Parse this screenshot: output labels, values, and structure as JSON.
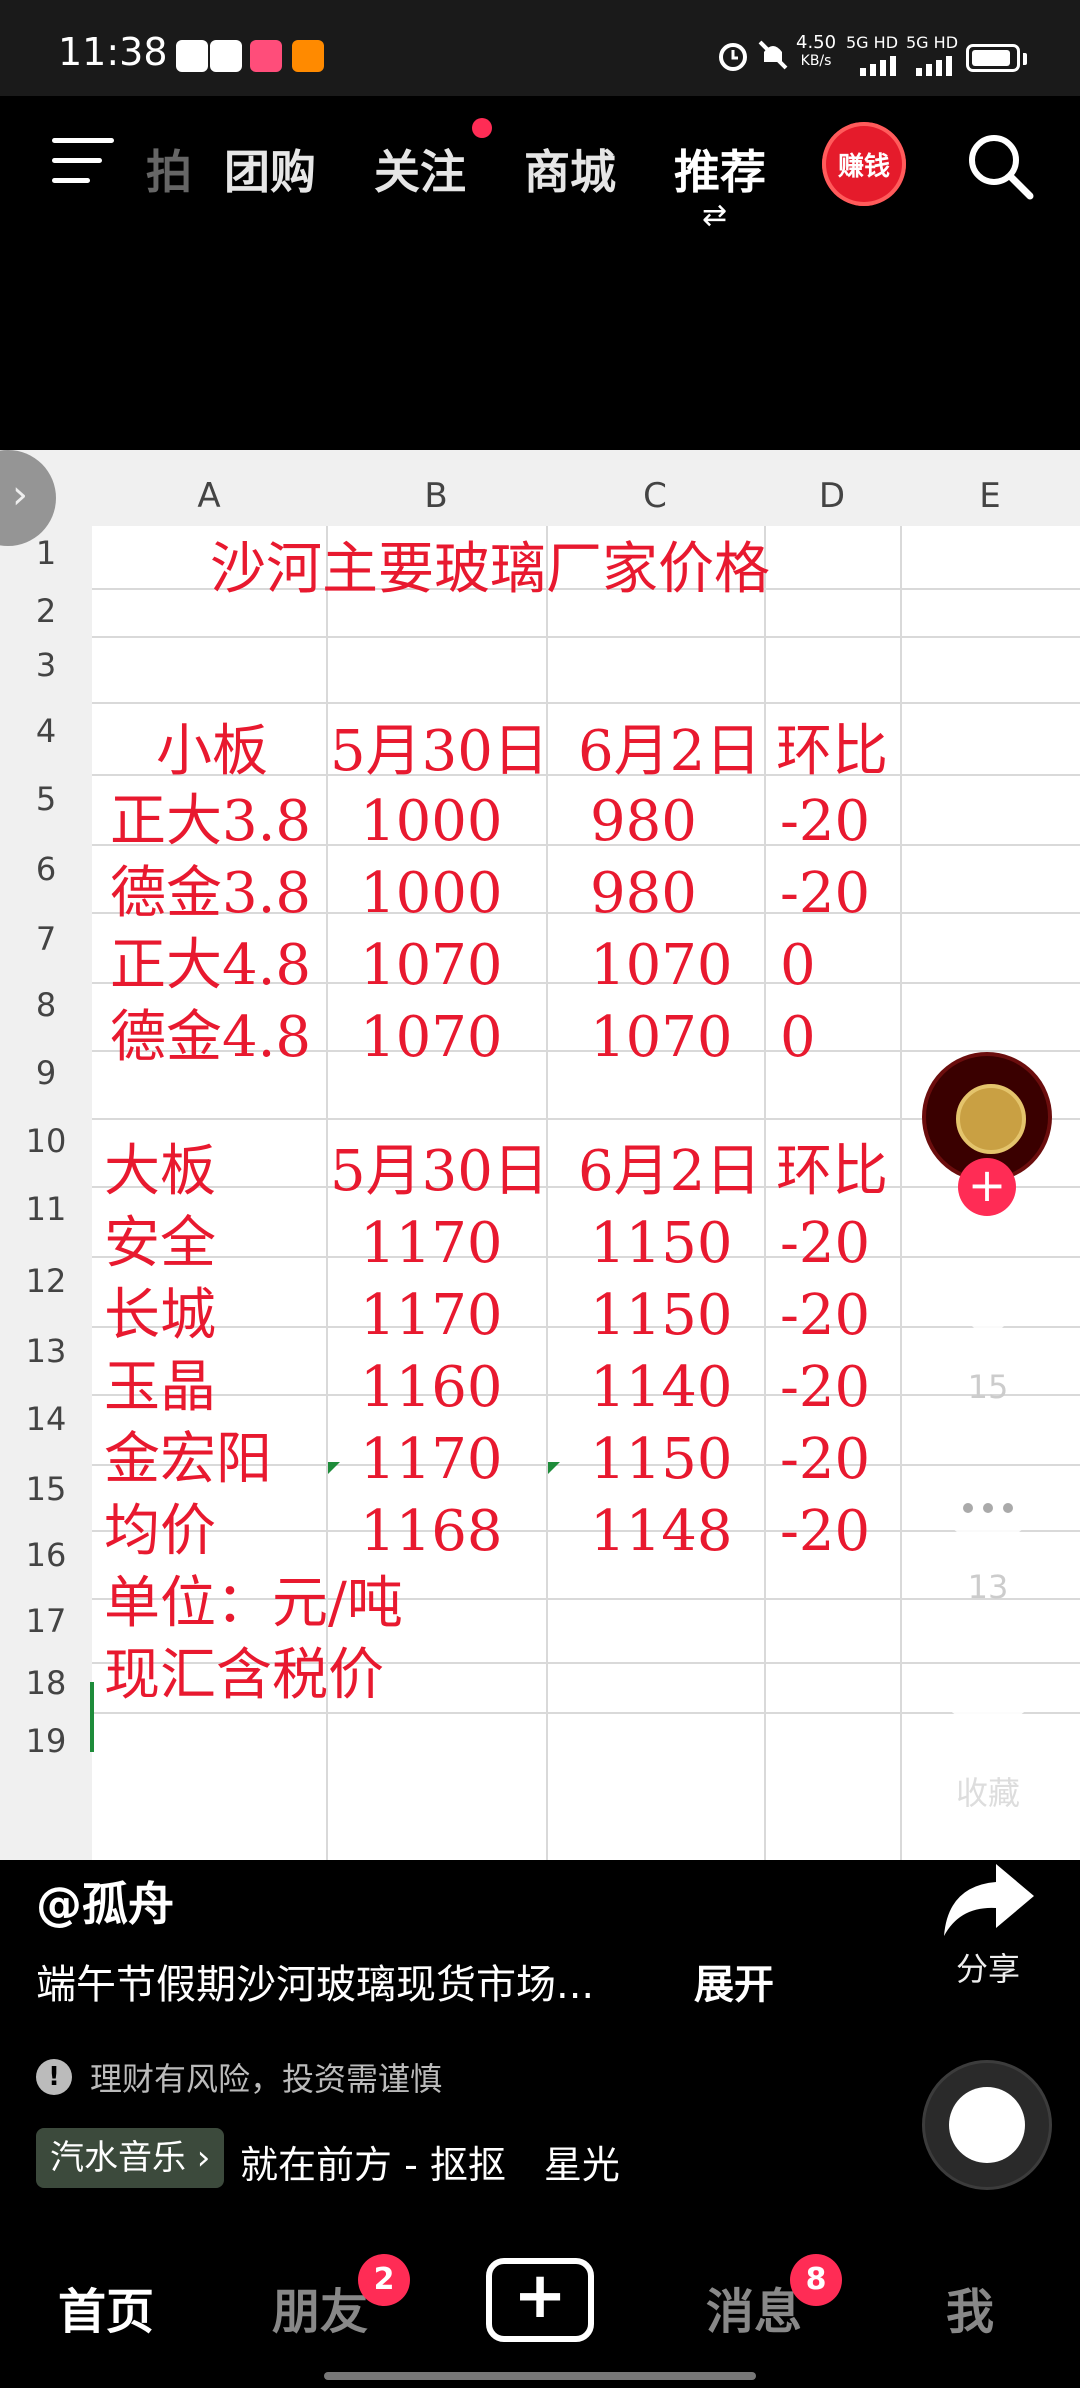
{
  "status": {
    "time": "11:38",
    "net_speed": "4.50",
    "net_unit": "KB/s",
    "sim1": "5G HD",
    "sim2": "5G HD"
  },
  "topnav": {
    "partial_tab": "拍",
    "tabs": [
      "团购",
      "关注",
      "商城",
      "推荐"
    ],
    "earn_label": "赚钱"
  },
  "sheet": {
    "columns": [
      "A",
      "B",
      "C",
      "D",
      "E"
    ],
    "rows": [
      "1",
      "2",
      "3",
      "4",
      "5",
      "6",
      "7",
      "8",
      "9",
      "10",
      "11",
      "12",
      "13",
      "14",
      "15",
      "16",
      "17",
      "18",
      "19"
    ],
    "title": "沙河主要玻璃厂家价格",
    "small": {
      "header": [
        "小板",
        "5月30日",
        "6月2日",
        "环比"
      ],
      "rows": [
        [
          "正大3.8",
          "1000",
          "980",
          "-20"
        ],
        [
          "德金3.8",
          "1000",
          "980",
          "-20"
        ],
        [
          "正大4.8",
          "1070",
          "1070",
          "0"
        ],
        [
          "德金4.8",
          "1070",
          "1070",
          "0"
        ]
      ]
    },
    "large": {
      "header": [
        "大板",
        "5月30日",
        "6月2日",
        "环比"
      ],
      "rows": [
        [
          "安全",
          "1170",
          "1150",
          "-20"
        ],
        [
          "长城",
          "1170",
          "1150",
          "-20"
        ],
        [
          "玉晶",
          "1160",
          "1140",
          "-20"
        ],
        [
          "金宏阳",
          "1170",
          "1150",
          "-20"
        ],
        [
          "均价",
          "1168",
          "1148",
          "-20"
        ]
      ]
    },
    "unit": "单位：元/吨",
    "note": "现汇含税价"
  },
  "side": {
    "likes": "15",
    "comments": "13",
    "favorite_label": "收藏",
    "share_label": "分享"
  },
  "post": {
    "author": "@孤舟",
    "description": "端午节假期沙河玻璃现货市场...",
    "more": "展开",
    "risk": "理财有风险，投资需谨慎",
    "music_tag": "汽水音乐 ›",
    "music": "就在前方 - 抠抠　星光"
  },
  "bottom": {
    "home": "首页",
    "friends": "朋友",
    "friends_badge": "2",
    "messages": "消息",
    "messages_badge": "8",
    "me": "我"
  },
  "colors": {
    "accent": "#ff2c55",
    "sheet_text": "#e8192f"
  }
}
